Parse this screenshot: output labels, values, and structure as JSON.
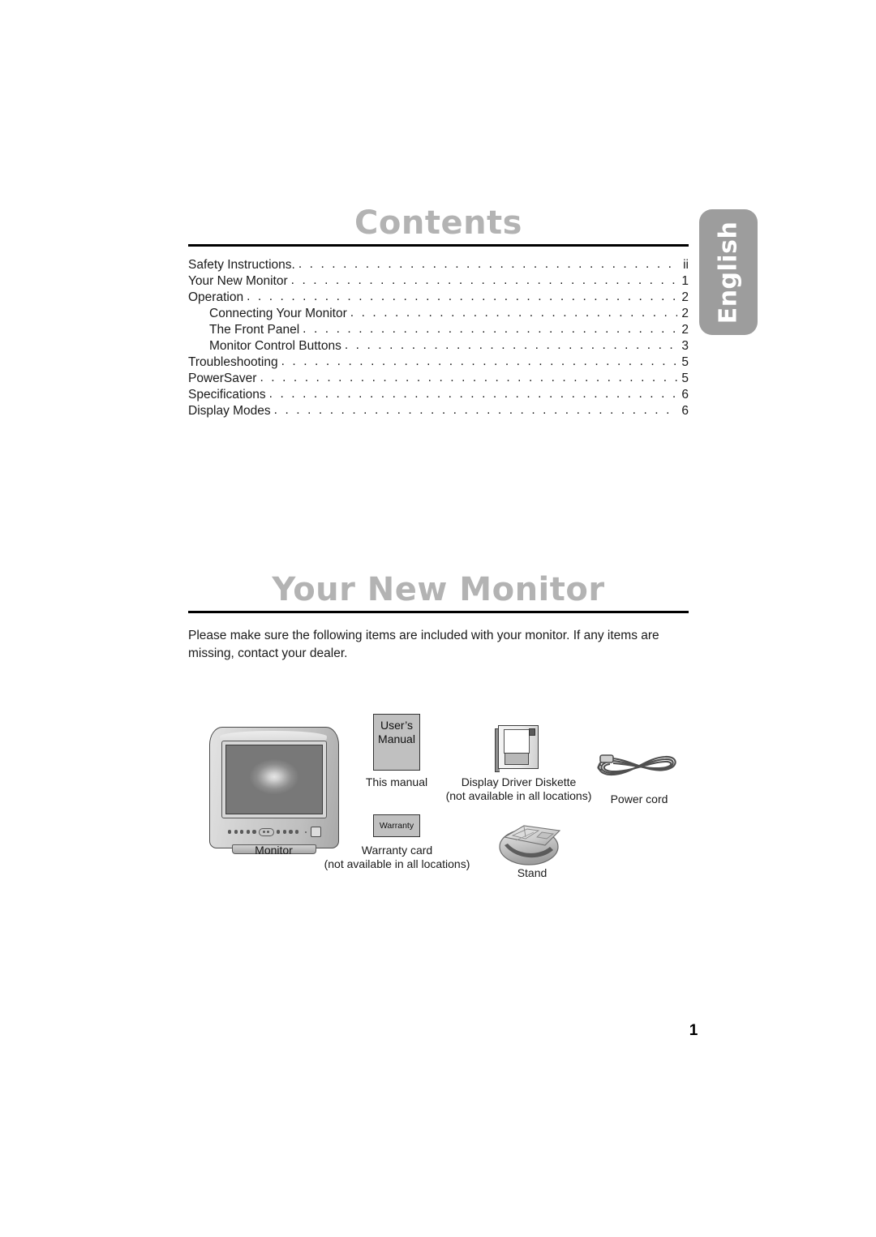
{
  "language_tab": {
    "label": "English",
    "background_color": "#9d9d9d",
    "text_color": "#ffffff"
  },
  "contents_section": {
    "title": "Contents",
    "title_color": "#b3b3b3",
    "entries": [
      {
        "label": "Safety Instructions.",
        "page": "ii",
        "indent": false
      },
      {
        "label": "Your New Monitor",
        "page": "1",
        "indent": false
      },
      {
        "label": "Operation",
        "page": "2",
        "indent": false
      },
      {
        "label": "Connecting Your Monitor",
        "page": "2",
        "indent": true
      },
      {
        "label": "The Front Panel",
        "page": "2",
        "indent": true
      },
      {
        "label": "Monitor Control Buttons",
        "page": "3",
        "indent": true
      },
      {
        "label": "Troubleshooting",
        "page": "5",
        "indent": false
      },
      {
        "label": "PowerSaver",
        "page": "5",
        "indent": false
      },
      {
        "label": "Specifications",
        "page": "6",
        "indent": false
      },
      {
        "label": "Display Modes",
        "page": "6",
        "indent": false
      }
    ],
    "leader_dots": ". . . . . . . . . . . . . . . . . . . . . . . . . . . . . . . . . . . . . . . . . . . . . . . . . . . . . . . . . . . . . . . . . . . . . . . . . . . . . . . . . . . . . . . . . . . . . . . . . . . . . . . . . . . . . ."
  },
  "monitor_section": {
    "title": "Your New Monitor",
    "title_color": "#b3b3b3",
    "intro": "Please make sure the following items are included with your monitor. If any items are missing, contact your dealer.",
    "items": {
      "monitor": {
        "caption": "Monitor"
      },
      "manual": {
        "cover_line1": "User’s",
        "cover_line2": "Manual",
        "caption": "This manual"
      },
      "warranty": {
        "cover_label": "Warranty",
        "caption_line1": "Warranty card",
        "caption_line2": "(not available in all locations)"
      },
      "diskette": {
        "caption_line1": "Display Driver Diskette",
        "caption_line2": "(not available in all locations)"
      },
      "power_cord": {
        "caption": "Power cord"
      },
      "stand": {
        "caption": "Stand"
      }
    }
  },
  "footer": {
    "page_number": "1"
  }
}
